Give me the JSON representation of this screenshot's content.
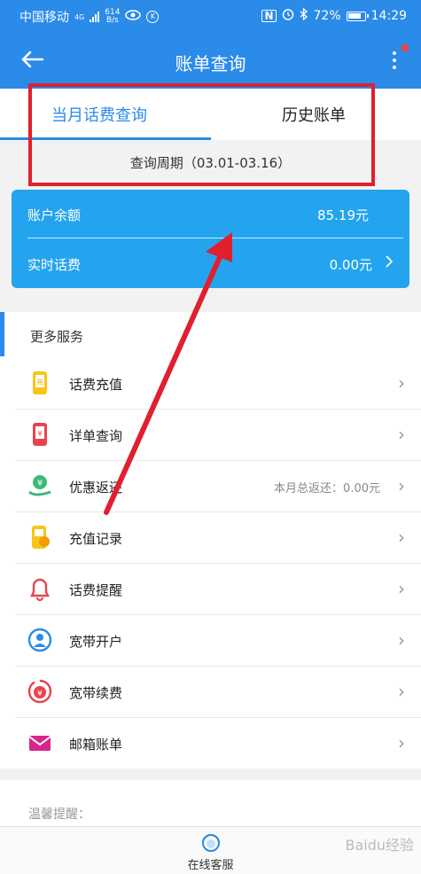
{
  "status_bar": {
    "carrier": "中国移动",
    "network": "4G",
    "speed_value": "614",
    "speed_unit": "B/s",
    "battery": "72%",
    "time": "14:29"
  },
  "header": {
    "title": "账单查询"
  },
  "tabs": [
    {
      "label": "当月话费查询",
      "active": true
    },
    {
      "label": "历史账单",
      "active": false
    }
  ],
  "period": "查询周期（03.01-03.16）",
  "balance_card": {
    "balance_label": "账户余额",
    "balance_value": "85.19元",
    "realtime_label": "实时话费",
    "realtime_value": "0.00元"
  },
  "services": {
    "heading": "更多服务",
    "items": [
      {
        "label": "话费充值",
        "icon": "recharge-icon",
        "extra": ""
      },
      {
        "label": "详单查询",
        "icon": "phone-bill-icon",
        "extra": ""
      },
      {
        "label": "优惠返还",
        "icon": "cashback-icon",
        "extra": "本月总返还：0.00元"
      },
      {
        "label": "充值记录",
        "icon": "record-icon",
        "extra": ""
      },
      {
        "label": "话费提醒",
        "icon": "bell-icon",
        "extra": ""
      },
      {
        "label": "宽带开户",
        "icon": "broadband-icon",
        "extra": ""
      },
      {
        "label": "宽带续费",
        "icon": "renew-icon",
        "extra": ""
      },
      {
        "label": "邮箱账单",
        "icon": "mail-icon",
        "extra": ""
      }
    ]
  },
  "tips": {
    "label": "温馨提醒："
  },
  "bottom_bar": {
    "label": "在线客服"
  },
  "watermark": "Baidu经验",
  "colors": {
    "accent": "#2a8be8",
    "card": "#24a4ee",
    "annotation": "#e0202f"
  }
}
